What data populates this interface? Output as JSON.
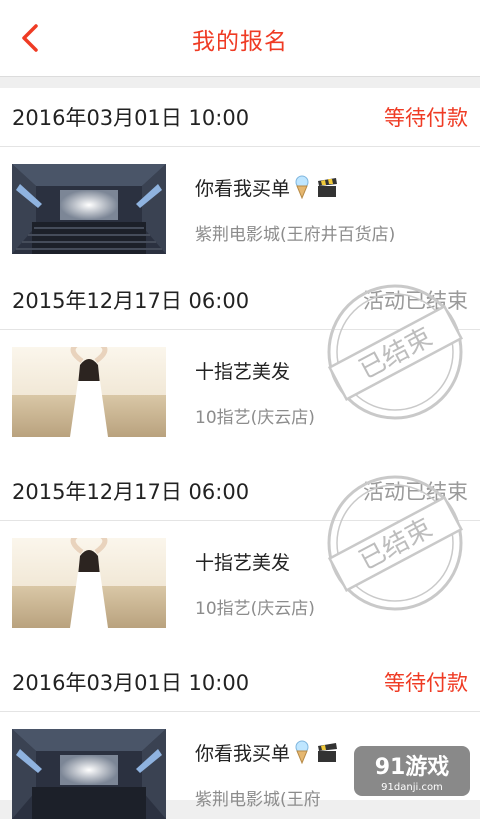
{
  "header": {
    "title": "我的报名",
    "back_icon": "chevron-left-icon",
    "accent_color": "#ef3b24"
  },
  "registrations": [
    {
      "date": "2016年03月01日 10:00",
      "status": "等待付款",
      "status_type": "pending",
      "title": "你看我买单",
      "venue": "紫荆电影城(王府井百货店)",
      "image": "cinema"
    },
    {
      "date": "2015年12月17日 06:00",
      "status": "活动已结束",
      "status_type": "ended",
      "stamp": "已结束",
      "title": "十指艺美发",
      "venue": "10指艺(庆云店)",
      "image": "woman"
    },
    {
      "date": "2015年12月17日 06:00",
      "status": "活动已结束",
      "status_type": "ended",
      "stamp": "已结束",
      "title": "十指艺美发",
      "venue": "10指艺(庆云店)",
      "image": "woman"
    },
    {
      "date": "2016年03月01日 10:00",
      "status": "等待付款",
      "status_type": "pending",
      "title": "你看我买单",
      "venue": "紫荆电影城(王府",
      "image": "cinema"
    }
  ],
  "watermark": {
    "brand": "91游戏",
    "url": "91danji.com"
  }
}
